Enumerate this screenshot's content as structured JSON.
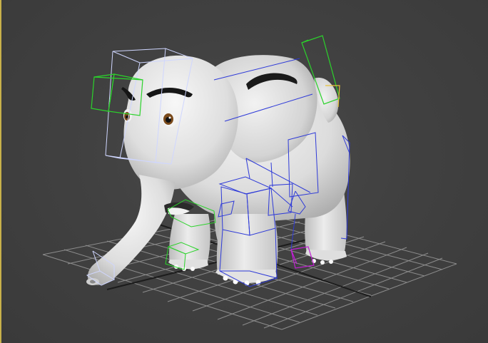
{
  "viewport": {
    "label": "",
    "colors": {
      "background": "#414141",
      "grid": "#9a9a9a",
      "grid_axis": "#1a1a1a",
      "model": "#e4e4e4",
      "bone_blue": "#2e3ad8",
      "bone_green": "#2bd32b",
      "bone_white": "#cfd6ff",
      "bone_magenta": "#c21fd6",
      "bone_yellow": "#e8c23a",
      "border_accent": "#c8b14a"
    }
  },
  "model": {
    "name": "elephant-character",
    "rig": [
      "head-bone",
      "left-ear-bone",
      "right-ear-bone",
      "trunk-bones",
      "spine-bones",
      "leg-bones",
      "foot-bones"
    ]
  }
}
